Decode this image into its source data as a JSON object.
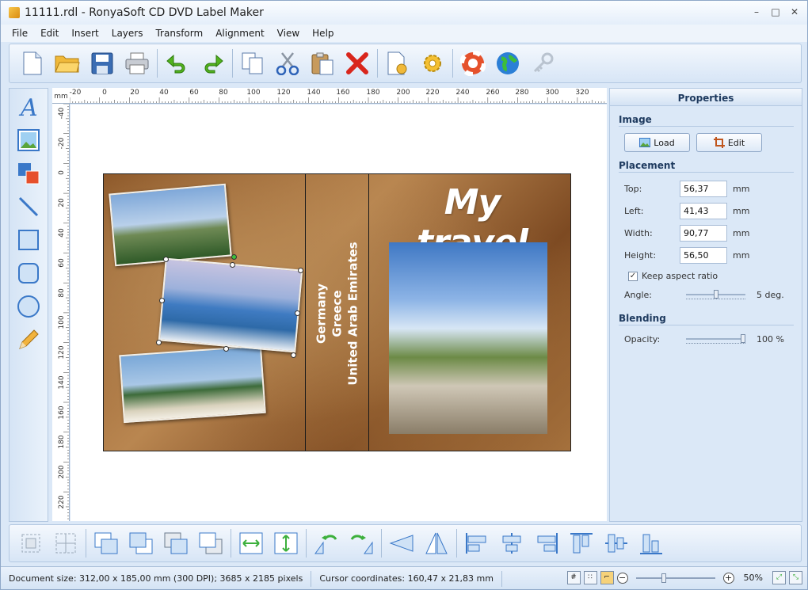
{
  "window": {
    "title": "11111.rdl - RonyaSoft CD DVD Label Maker",
    "minimize": "–",
    "maximize": "□",
    "close": "✕"
  },
  "menu": [
    "File",
    "Edit",
    "Insert",
    "Layers",
    "Transform",
    "Alignment",
    "View",
    "Help"
  ],
  "toolbar": {
    "icons": [
      "new-icon",
      "open-icon",
      "save-icon",
      "print-icon",
      "undo-icon",
      "redo-icon",
      "copy-icon",
      "cut-icon",
      "paste-icon",
      "delete-icon",
      "page-setup-icon",
      "settings-icon",
      "help-icon",
      "web-icon",
      "key-icon"
    ]
  },
  "tools": {
    "icons": [
      "text-tool-icon",
      "image-tool-icon",
      "layers-tool-icon",
      "line-tool-icon",
      "rectangle-tool-icon",
      "rounded-rectangle-tool-icon",
      "ellipse-tool-icon",
      "pencil-tool-icon"
    ]
  },
  "ruler": {
    "unit": "mm",
    "top_labels": [
      "-20",
      "0",
      "20",
      "40",
      "60",
      "80",
      "100",
      "120",
      "140",
      "160",
      "180",
      "200",
      "220",
      "240",
      "260",
      "280",
      "300",
      "320"
    ],
    "left_labels": [
      "-40",
      "-20",
      "0",
      "20",
      "40",
      "60",
      "80",
      "100",
      "120",
      "140",
      "160",
      "180",
      "200",
      "220"
    ]
  },
  "label": {
    "front_title": "My travel",
    "spine_lines": [
      "Germany",
      "Greece",
      "United Arab Emirates"
    ]
  },
  "properties": {
    "header": "Properties",
    "image_section": "Image",
    "load_label": "Load",
    "edit_label": "Edit",
    "placement_section": "Placement",
    "top_label": "Top:",
    "top_value": "56,37",
    "left_label": "Left:",
    "left_value": "41,43",
    "width_label": "Width:",
    "width_value": "90,77",
    "height_label": "Height:",
    "height_value": "56,50",
    "unit": "mm",
    "keep_aspect_label": "Keep aspect ratio",
    "keep_aspect_checked": true,
    "angle_label": "Angle:",
    "angle_value": "5 deg.",
    "angle_fraction": 0.5,
    "blending_section": "Blending",
    "opacity_label": "Opacity:",
    "opacity_value": "100 %",
    "opacity_fraction": 1.0
  },
  "bottom_toolbar": {
    "icons": [
      "group-icon",
      "ungroup-icon",
      "bring-front-icon",
      "send-back-icon",
      "bring-forward-icon",
      "send-backward-icon",
      "fit-width-icon",
      "fit-height-icon",
      "rotate-left-icon",
      "rotate-right-icon",
      "flip-horizontal-icon",
      "flip-vertical-icon",
      "align-left-icon",
      "align-center-icon",
      "align-right-icon",
      "align-top-icon",
      "align-middle-icon",
      "align-bottom-icon"
    ]
  },
  "status": {
    "document_size": "Document size: 312,00 x 185,00 mm (300 DPI); 3685 x 2185 pixels",
    "cursor": "Cursor coordinates: 160,47 x 21,83 mm",
    "zoom": "50%",
    "zoom_fraction": 0.35
  }
}
